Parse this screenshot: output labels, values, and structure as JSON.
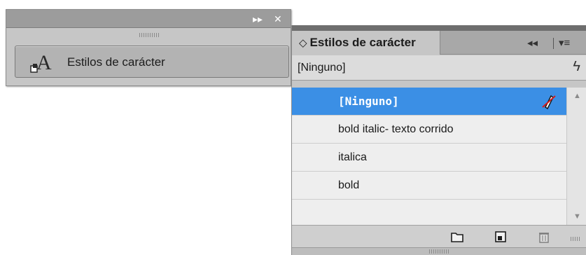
{
  "left_panel": {
    "titlebar_controls": {
      "collapse_glyph": "▸▸",
      "close_glyph": "✕"
    },
    "item_label": "Estilos de carácter"
  },
  "right_panel": {
    "tab": {
      "arrows_glyph": "◇",
      "label": "Estilos de carácter"
    },
    "tab_controls": {
      "expand_glyph": "◂◂",
      "menu_glyph": "▾≡"
    },
    "current_style": "[Ninguno]",
    "bolt_glyph": "ϟ",
    "styles": [
      {
        "label": "[Ninguno]",
        "selected": true
      },
      {
        "label": "bold italic- texto corrido",
        "selected": false
      },
      {
        "label": "italica",
        "selected": false
      },
      {
        "label": "bold",
        "selected": false
      },
      {
        "label": "",
        "selected": false
      }
    ],
    "footer_icons": [
      "folder-icon",
      "new-style-icon",
      "trash-icon"
    ]
  },
  "colors": {
    "selection": "#3b8fe5",
    "panel_bg": "#c6c6c6",
    "list_bg": "#eeeeee"
  }
}
